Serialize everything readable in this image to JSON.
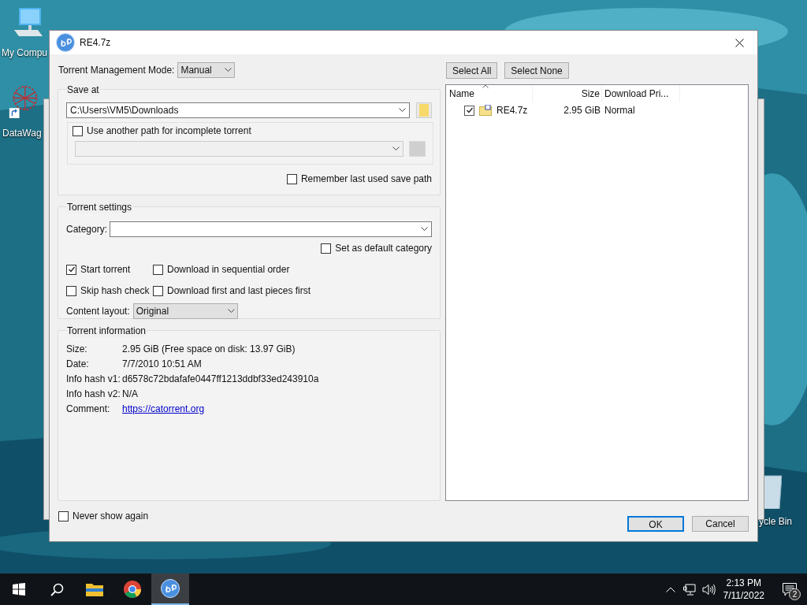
{
  "desktop_icons": [
    {
      "label": "My Compu",
      "kind": "computer"
    },
    {
      "label": "DataWag",
      "kind": "network"
    },
    {
      "label": "ycle Bin",
      "kind": "bin"
    }
  ],
  "dialog": {
    "title": "RE4.7z",
    "management_mode": {
      "label": "Torrent Management Mode:",
      "value": "Manual"
    },
    "save_at": {
      "title": "Save at",
      "path": "C:\\Users\\VM5\\Downloads",
      "incomplete": {
        "label": "Use another path for incomplete torrent",
        "checked": false
      },
      "remember": {
        "label": "Remember last used save path",
        "checked": false
      }
    },
    "torrent_settings": {
      "title": "Torrent settings",
      "category_label": "Category:",
      "default_category": {
        "label": "Set as default category",
        "checked": false
      },
      "options": [
        {
          "label": "Start torrent",
          "checked": true
        },
        {
          "label": "Download in sequential order",
          "checked": false
        },
        {
          "label": "Skip hash check",
          "checked": false
        },
        {
          "label": "Download first and last pieces first",
          "checked": false
        }
      ],
      "content_layout": {
        "label": "Content layout:",
        "value": "Original"
      }
    },
    "torrent_info": {
      "title": "Torrent information",
      "rows": [
        {
          "label": "Size:",
          "value": "2.95 GiB (Free space on disk: 13.97 GiB)",
          "kind": "text"
        },
        {
          "label": "Date:",
          "value": "7/7/2010 10:51 AM",
          "kind": "text"
        },
        {
          "label": "Info hash v1:",
          "value": "d6578c72bdafafe0447ff1213ddbf33ed243910a",
          "kind": "text"
        },
        {
          "label": "Info hash v2:",
          "value": "N/A",
          "kind": "text"
        },
        {
          "label": "Comment:",
          "value": "https://catorrent.org",
          "kind": "link"
        }
      ]
    },
    "select_buttons": [
      "Select All",
      "Select None"
    ],
    "files": {
      "columns": [
        "Name",
        "Size",
        "Download Pri..."
      ],
      "rows": [
        {
          "name": "RE4.7z",
          "size": "2.95 GiB",
          "priority": "Normal",
          "checked": true
        }
      ]
    },
    "never_show": {
      "label": "Never show again",
      "checked": false
    },
    "buttons": [
      {
        "label": "OK",
        "default": true
      },
      {
        "label": "Cancel",
        "default": false
      }
    ]
  },
  "taskbar": {
    "items": [
      {
        "kind": "start",
        "selected": false
      },
      {
        "kind": "search",
        "selected": false
      },
      {
        "kind": "explorer",
        "selected": false
      },
      {
        "kind": "chrome",
        "selected": false
      },
      {
        "kind": "qbittorrent",
        "selected": true
      }
    ],
    "time": "2:13 PM",
    "date": "7/11/2022",
    "notifications": "2"
  }
}
